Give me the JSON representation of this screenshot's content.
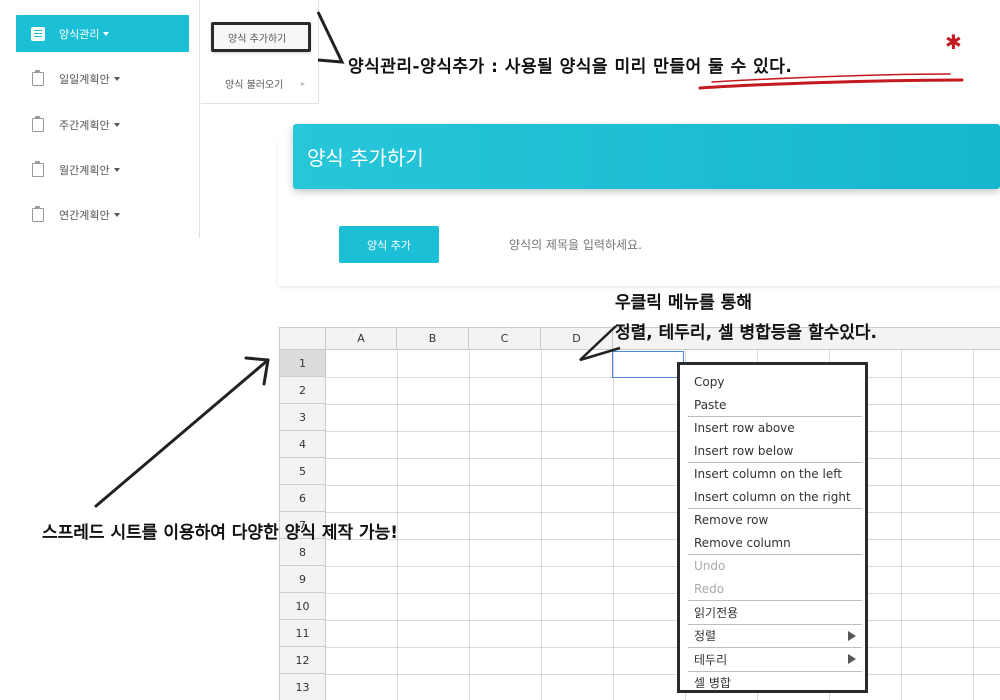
{
  "sidebar": {
    "items": [
      {
        "label": "양식관리",
        "active": true,
        "icon": "book-icon"
      },
      {
        "label": "일일계획안",
        "active": false,
        "icon": "clipboard-icon"
      },
      {
        "label": "주간계획안",
        "active": false,
        "icon": "clipboard-icon"
      },
      {
        "label": "월간계획안",
        "active": false,
        "icon": "clipboard-icon"
      },
      {
        "label": "연간계획안",
        "active": false,
        "icon": "clipboard-icon"
      }
    ]
  },
  "submenu": {
    "add_label": "양식 추가하기",
    "load_label": "양식 불러오기"
  },
  "card": {
    "title": "양식 추가하기",
    "add_button": "양식 추가",
    "title_placeholder": "양식의 제목을 입력하세요."
  },
  "sheet": {
    "columns": [
      "A",
      "B",
      "C",
      "D"
    ],
    "rows": [
      "1",
      "2",
      "3",
      "4",
      "5",
      "6",
      "7",
      "8",
      "9",
      "10",
      "11",
      "12",
      "13"
    ]
  },
  "context_menu": {
    "groups": [
      [
        {
          "label": "Copy"
        },
        {
          "label": "Paste"
        }
      ],
      [
        {
          "label": "Insert row above"
        },
        {
          "label": "Insert row below"
        }
      ],
      [
        {
          "label": "Insert column on the left"
        },
        {
          "label": "Insert column on the right"
        }
      ],
      [
        {
          "label": "Remove row"
        },
        {
          "label": "Remove column"
        }
      ],
      [
        {
          "label": "Undo",
          "disabled": true
        },
        {
          "label": "Redo",
          "disabled": true
        }
      ],
      [
        {
          "label": "읽기전용"
        }
      ],
      [
        {
          "label": "정렬",
          "submenu": true
        }
      ],
      [
        {
          "label": "테두리",
          "submenu": true
        }
      ],
      [
        {
          "label": "셀 병합"
        }
      ]
    ]
  },
  "annotations": {
    "top": "양식관리-양식추가 : 사용될 양식을 미리 만들어 둘 수 있다.",
    "right_line1": "우클릭 메뉴를 통해",
    "right_line2": "정렬, 테두리, 셀 병합등을 할수있다.",
    "left": "스프레드 시트를 이용하여 다양한 양식 제작 가능!"
  },
  "colors": {
    "accent": "#1bbfd6",
    "annotation_underline": "#c4191e",
    "selection": "#4b89dc"
  }
}
